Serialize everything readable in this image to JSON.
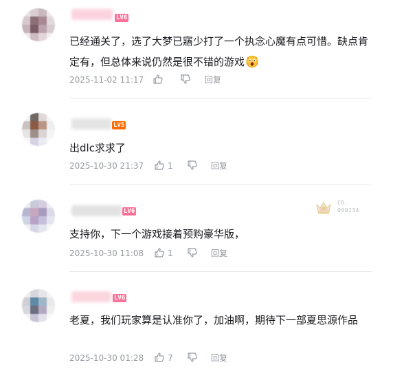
{
  "comments": [
    {
      "level": "LV6",
      "level_color": "#fb7299",
      "text": "已经通关了，选了大梦已寤少打了一个执念心魔有点可惜。缺点肯定有，但总体来说仍然是很不错的游戏",
      "emoji": "surprised-face-emoji",
      "time": "2025-11-02 11:17",
      "likes": "",
      "reply_label": "回复"
    },
    {
      "level": "LV5",
      "level_color": "#ff6c00",
      "text": "出dlc求求了",
      "time": "2025-10-30 21:37",
      "likes": "1",
      "reply_label": "回复"
    },
    {
      "level": "LV6",
      "level_color": "#fb7299",
      "text": "支持你，下一个游戏接着预购豪华版，",
      "time": "2025-10-30 11:08",
      "likes": "1",
      "reply_label": "回复",
      "fan_badge": {
        "name": "CD.",
        "number": "000234"
      }
    },
    {
      "level": "LV6",
      "level_color": "#fb7299",
      "text": "老夏，我们玩家算是认准你了，加油啊，期待下一部夏思源作品",
      "time": "2025-10-30 01:28",
      "likes": "7",
      "reply_label": "回复"
    }
  ],
  "icons": {
    "like": "thumbs-up-icon",
    "dislike": "thumbs-down-icon"
  },
  "colors": {
    "meta_gray": "#9499a0",
    "divider": "#e3e5e7"
  }
}
